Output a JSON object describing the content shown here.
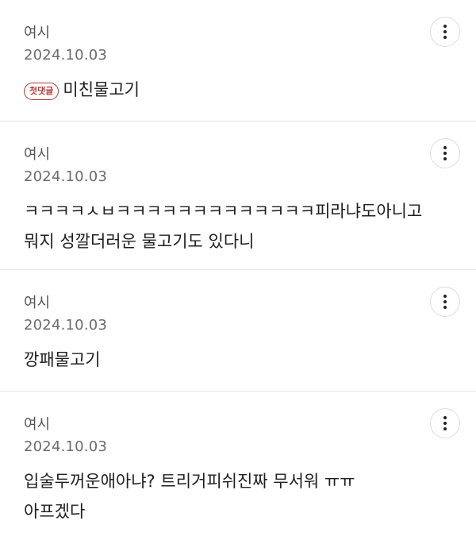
{
  "comments": [
    {
      "author": "여시",
      "date": "2024.10.03",
      "badge": "첫댓글",
      "lines": [
        "미친물고기"
      ]
    },
    {
      "author": "여시",
      "date": "2024.10.03",
      "lines": [
        "ㅋㅋㅋㅋㅅㅂㅋㅋㅋㅋㅋㅋㅋㅋㅋㅋㅋㅋㅋ피라냐도아니고",
        "뭐지 성깔더러운 물고기도 있다니"
      ]
    },
    {
      "author": "여시",
      "date": "2024.10.03",
      "lines": [
        "깡패물고기"
      ]
    },
    {
      "author": "여시",
      "date": "2024.10.03",
      "lines": [
        "입술두꺼운애아냐? 트리거피쉬진짜 무서워 ㅠㅠ",
        "아프겠다"
      ]
    }
  ],
  "icons": {
    "more": "more-vertical-icon"
  },
  "colors": {
    "badge": "#b23a3a",
    "divider": "#e6e6e6"
  }
}
